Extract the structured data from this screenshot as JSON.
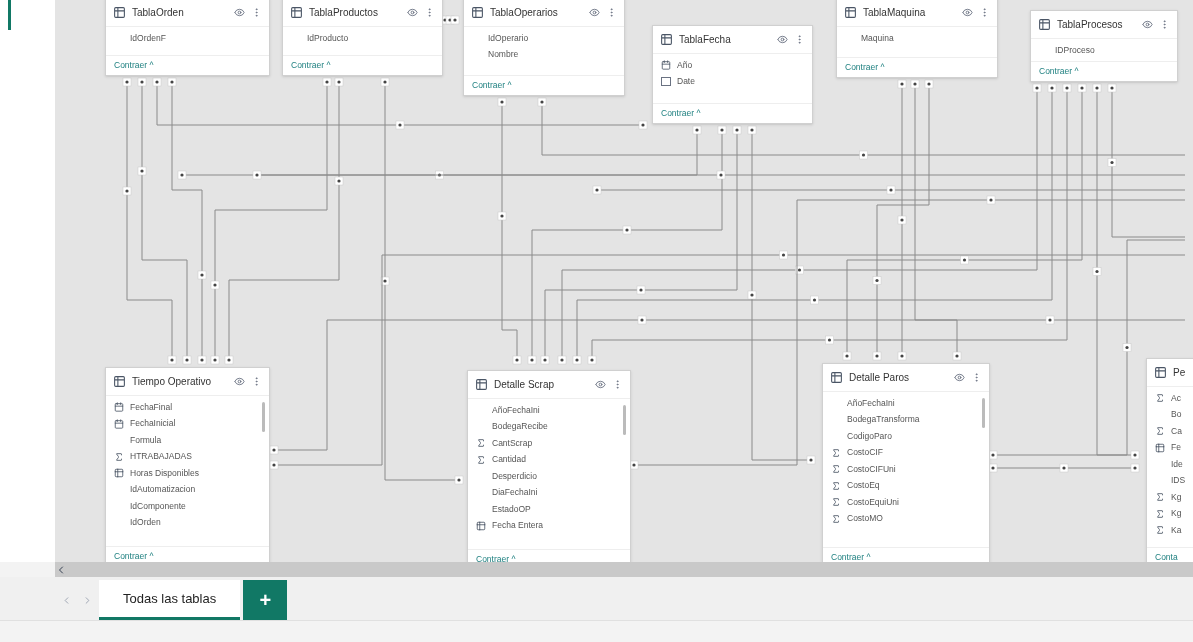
{
  "tables": [
    {
      "title": "TablaOrden",
      "fields": [
        {
          "name": "IdOrdenF",
          "kind": "plain"
        }
      ],
      "collapse_link": "Contraer ^"
    },
    {
      "title": "TablaProductos",
      "fields": [
        {
          "name": "IdProducto",
          "kind": "plain"
        }
      ],
      "collapse_link": "Contraer ^"
    },
    {
      "title": "TablaOperarios",
      "fields": [
        {
          "name": "IdOperario",
          "kind": "plain"
        },
        {
          "name": "Nombre",
          "kind": "plain"
        }
      ],
      "collapse_link": "Contraer ^"
    },
    {
      "title": "TablaFecha",
      "fields": [
        {
          "name": "Año",
          "kind": "calendar"
        },
        {
          "name": "Date",
          "kind": "date"
        }
      ],
      "collapse_link": "Contraer ^"
    },
    {
      "title": "TablaMaquina",
      "fields": [
        {
          "name": "Maquina",
          "kind": "plain"
        }
      ],
      "collapse_link": "Contraer ^"
    },
    {
      "title": "TablaProcesos",
      "fields": [
        {
          "name": "IDProceso",
          "kind": "plain"
        }
      ],
      "collapse_link": "Contraer ^"
    },
    {
      "title": "Tiempo Operativo",
      "fields": [
        {
          "name": "FechaFinal",
          "kind": "calendar"
        },
        {
          "name": "FechaInicial",
          "kind": "calendar"
        },
        {
          "name": "Formula",
          "kind": "plain"
        },
        {
          "name": "HTRABAJADAS",
          "kind": "sigma"
        },
        {
          "name": "Horas Disponibles",
          "kind": "calc"
        },
        {
          "name": "IdAutomatizacion",
          "kind": "plain"
        },
        {
          "name": "IdComponente",
          "kind": "plain"
        },
        {
          "name": "IdOrden",
          "kind": "plain"
        }
      ],
      "collapse_link": "Contraer ^"
    },
    {
      "title": "Detalle Scrap",
      "fields": [
        {
          "name": "AñoFechaIni",
          "kind": "plain"
        },
        {
          "name": "BodegaRecibe",
          "kind": "plain"
        },
        {
          "name": "CantScrap",
          "kind": "sigma"
        },
        {
          "name": "Cantidad",
          "kind": "sigma"
        },
        {
          "name": "Desperdicio",
          "kind": "plain"
        },
        {
          "name": "DiaFechaIni",
          "kind": "plain"
        },
        {
          "name": "EstadoOP",
          "kind": "plain"
        },
        {
          "name": "Fecha Entera",
          "kind": "calc"
        }
      ],
      "collapse_link": "Contraer ^"
    },
    {
      "title": "Detalle Paros",
      "fields": [
        {
          "name": "AñoFechaIni",
          "kind": "plain"
        },
        {
          "name": "BodegaTransforma",
          "kind": "plain"
        },
        {
          "name": "CodigoParo",
          "kind": "plain"
        },
        {
          "name": "CostoCIF",
          "kind": "sigma"
        },
        {
          "name": "CostoCIFUni",
          "kind": "sigma"
        },
        {
          "name": "CostoEq",
          "kind": "sigma"
        },
        {
          "name": "CostoEquiUni",
          "kind": "sigma"
        },
        {
          "name": "CostoMO",
          "kind": "sigma"
        }
      ],
      "collapse_link": "Contraer ^"
    },
    {
      "title": "Pe",
      "fields": [
        {
          "name": "Ac",
          "kind": "sigma"
        },
        {
          "name": "Bo",
          "kind": "plain"
        },
        {
          "name": "Ca",
          "kind": "sigma"
        },
        {
          "name": "Fe",
          "kind": "calc"
        },
        {
          "name": "Ide",
          "kind": "plain"
        },
        {
          "name": "IDS",
          "kind": "plain"
        },
        {
          "name": "Kg",
          "kind": "sigma"
        },
        {
          "name": "Kg",
          "kind": "sigma"
        },
        {
          "name": "Ka",
          "kind": "sigma"
        }
      ],
      "collapse_link": "Conta"
    }
  ],
  "tabs": [
    {
      "label": "Todas las tablas",
      "selected": true
    }
  ],
  "add_tab_button": "+"
}
